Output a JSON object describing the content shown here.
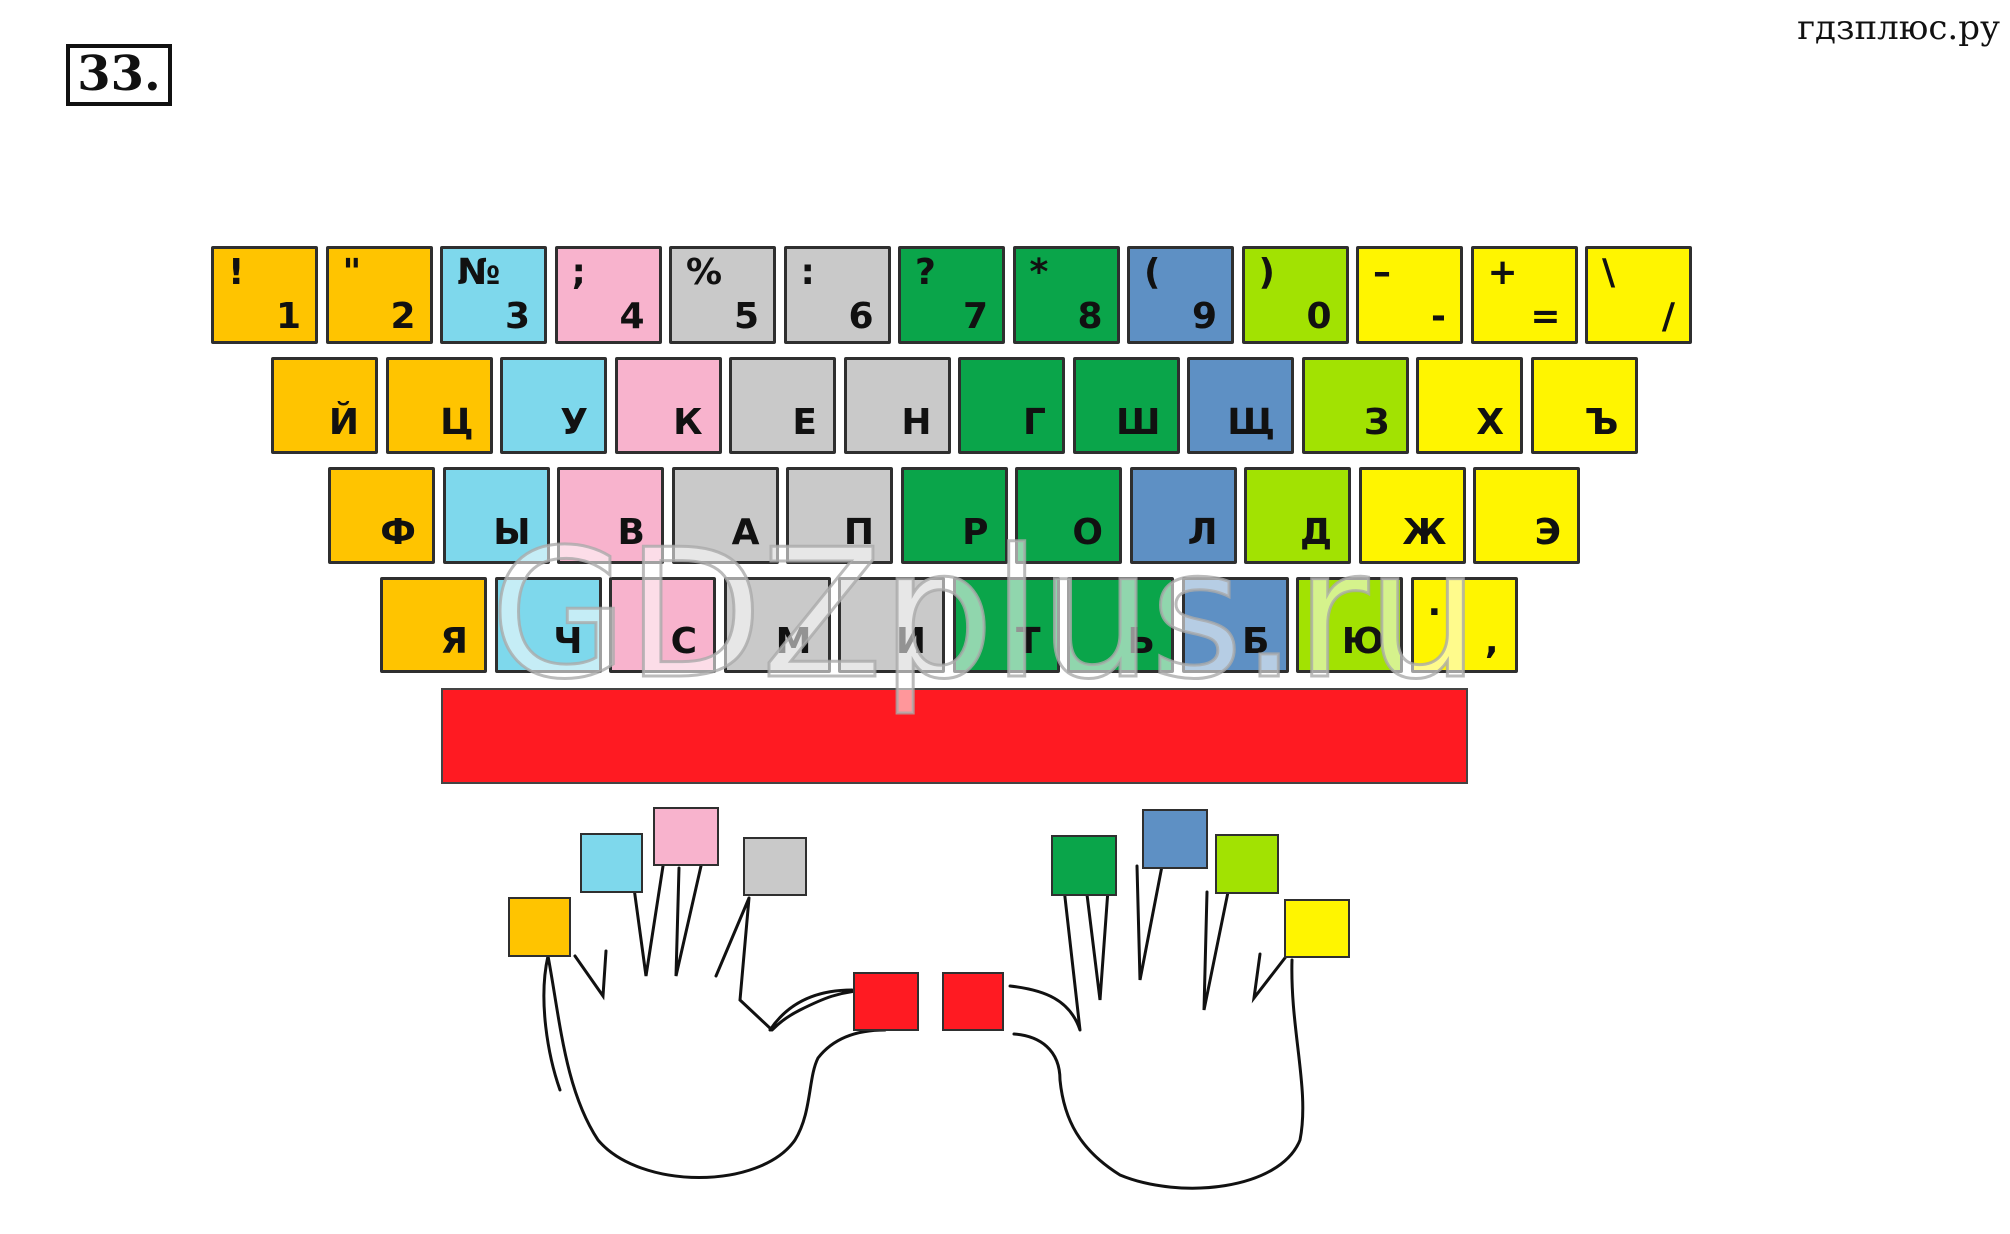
{
  "header": {
    "task_number": "33.",
    "site_label": "гдзплюс.ру"
  },
  "watermark": "GDZplus.ru",
  "colors": {
    "orange": "#ffc400",
    "cyan": "#7ed8ec",
    "pink": "#f8b3cd",
    "gray": "#c9c9c9",
    "dark_green": "#0aa54a",
    "steel_blue": "#5e90c4",
    "lime": "#a2e202",
    "yellow": "#fff500",
    "red": "#ff1a22"
  },
  "keyboard": {
    "number_row": [
      {
        "top": "!",
        "bottom": "1",
        "color": "orange"
      },
      {
        "top": "\"",
        "bottom": "2",
        "color": "orange"
      },
      {
        "top": "№",
        "bottom": "3",
        "color": "cyan"
      },
      {
        "top": ";",
        "bottom": "4",
        "color": "pink"
      },
      {
        "top": "%",
        "bottom": "5",
        "color": "gray"
      },
      {
        "top": ":",
        "bottom": "6",
        "color": "gray"
      },
      {
        "top": "?",
        "bottom": "7",
        "color": "dark_green"
      },
      {
        "top": "*",
        "bottom": "8",
        "color": "dark_green"
      },
      {
        "top": "(",
        "bottom": "9",
        "color": "steel_blue"
      },
      {
        "top": ")",
        "bottom": "0",
        "color": "lime"
      },
      {
        "top": "–",
        "bottom": "-",
        "color": "yellow"
      },
      {
        "top": "+",
        "bottom": "=",
        "color": "yellow"
      },
      {
        "top": "\\",
        "bottom": "/",
        "color": "yellow"
      }
    ],
    "top_row": [
      {
        "label": "Й",
        "color": "orange"
      },
      {
        "label": "Ц",
        "color": "orange"
      },
      {
        "label": "У",
        "color": "cyan"
      },
      {
        "label": "К",
        "color": "pink"
      },
      {
        "label": "Е",
        "color": "gray"
      },
      {
        "label": "Н",
        "color": "gray"
      },
      {
        "label": "Г",
        "color": "dark_green"
      },
      {
        "label": "Ш",
        "color": "dark_green"
      },
      {
        "label": "Щ",
        "color": "steel_blue"
      },
      {
        "label": "З",
        "color": "lime"
      },
      {
        "label": "Х",
        "color": "yellow"
      },
      {
        "label": "Ъ",
        "color": "yellow"
      }
    ],
    "home_row": [
      {
        "label": "Ф",
        "color": "orange"
      },
      {
        "label": "Ы",
        "color": "cyan"
      },
      {
        "label": "В",
        "color": "pink"
      },
      {
        "label": "А",
        "color": "gray"
      },
      {
        "label": "П",
        "color": "gray"
      },
      {
        "label": "Р",
        "color": "dark_green"
      },
      {
        "label": "О",
        "color": "dark_green"
      },
      {
        "label": "Л",
        "color": "steel_blue"
      },
      {
        "label": "Д",
        "color": "lime"
      },
      {
        "label": "Ж",
        "color": "yellow"
      },
      {
        "label": "Э",
        "color": "yellow"
      }
    ],
    "bottom_row": [
      {
        "label": "Я",
        "color": "orange"
      },
      {
        "label": "Ч",
        "color": "cyan"
      },
      {
        "label": "С",
        "color": "pink"
      },
      {
        "label": "М",
        "color": "gray"
      },
      {
        "label": "И",
        "color": "gray"
      },
      {
        "label": "Т",
        "color": "dark_green"
      },
      {
        "label": "Ь",
        "color": "dark_green"
      },
      {
        "label": "Б",
        "color": "steel_blue"
      },
      {
        "label": "Ю",
        "color": "lime"
      },
      {
        "top": ".",
        "label": ",",
        "color": "yellow"
      }
    ],
    "spacebar_color": "red"
  },
  "fingers": {
    "left_hand": [
      {
        "finger": "pinky",
        "color": "orange"
      },
      {
        "finger": "ring",
        "color": "cyan"
      },
      {
        "finger": "middle",
        "color": "pink"
      },
      {
        "finger": "index",
        "color": "gray"
      },
      {
        "finger": "thumb",
        "color": "red"
      }
    ],
    "right_hand": [
      {
        "finger": "thumb",
        "color": "red"
      },
      {
        "finger": "index",
        "color": "dark_green"
      },
      {
        "finger": "middle",
        "color": "steel_blue"
      },
      {
        "finger": "ring",
        "color": "lime"
      },
      {
        "finger": "pinky",
        "color": "yellow"
      }
    ]
  }
}
